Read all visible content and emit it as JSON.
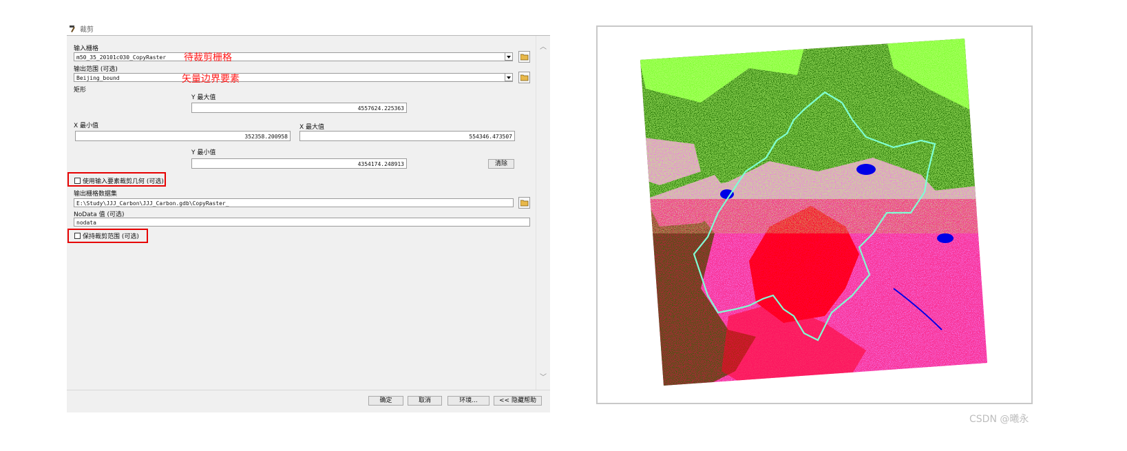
{
  "dialog": {
    "title": "裁剪",
    "input_raster": {
      "label": "输入栅格",
      "value": "m50_35_20101c030_CopyRaster",
      "annotation": "待裁剪栅格"
    },
    "output_extent": {
      "label": "输出范围 (可选)",
      "value": "Beijing_bound",
      "annotation": "矢量边界要素"
    },
    "rectangle": {
      "label": "矩形",
      "y_max_label": "Y 最大值",
      "y_max": "4557624.225363",
      "x_min_label": "X 最小值",
      "x_min": "352358.200958",
      "x_max_label": "X 最大值",
      "x_max": "554346.473507",
      "y_min_label": "Y 最小值",
      "y_min": "4354174.248913",
      "clear_button": "清除"
    },
    "use_input_geometry": {
      "label": "使用输入要素裁剪几何 (可选)",
      "checked": false
    },
    "output_dataset": {
      "label": "输出栅格数据集",
      "value": "E:\\Study\\JJJ_Carbon\\JJJ_Carbon.gdb\\CopyRaster_"
    },
    "nodata": {
      "label": "NoData 值 (可选)",
      "value": "nodata"
    },
    "maintain_extent": {
      "label": "保持裁剪范围 (可选)",
      "checked": false
    },
    "buttons": {
      "ok": "确定",
      "cancel": "取消",
      "env": "环境...",
      "help": "<< 隐藏帮助"
    }
  },
  "map": {
    "colors": {
      "forest": "#1e6e00",
      "grassland": "#7cff2e",
      "cropland": "#f276e9",
      "urban": "#ff0000",
      "water": "#0000e6",
      "boundary": "#7fffd4"
    }
  },
  "watermark": "CSDN @曦永"
}
